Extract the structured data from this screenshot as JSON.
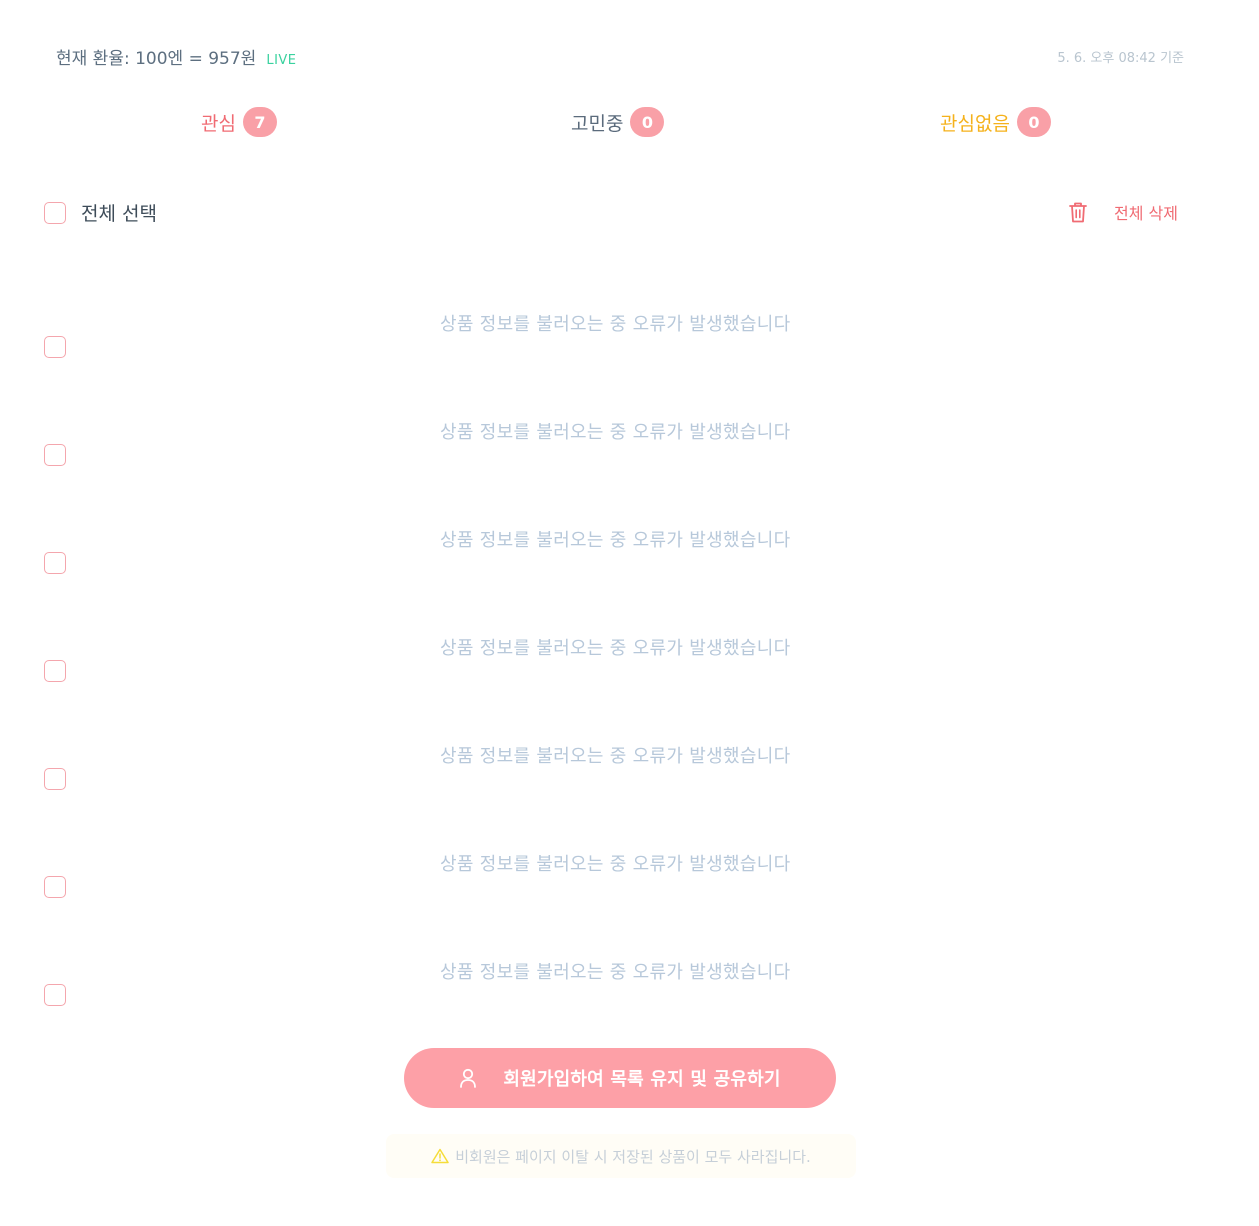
{
  "header": {
    "exchange_rate": "현재 환율: 100엔 = 957원",
    "live_label": "LIVE",
    "updated_text": "5. 6. 오후 08:42 기준"
  },
  "tabs": [
    {
      "label": "관심",
      "count": "7",
      "color": "#f06b73"
    },
    {
      "label": "고민중",
      "count": "0",
      "color": "#5b6b7c"
    },
    {
      "label": "관심없음",
      "count": "0",
      "color": "#f5b21c"
    }
  ],
  "selection": {
    "select_all_label": "전체 선택",
    "delete_all_label": "전체 삭제"
  },
  "items": [
    {
      "message": "상품 정보를 불러오는 중 오류가 발생했습니다"
    },
    {
      "message": "상품 정보를 불러오는 중 오류가 발생했습니다"
    },
    {
      "message": "상품 정보를 불러오는 중 오류가 발생했습니다"
    },
    {
      "message": "상품 정보를 불러오는 중 오류가 발생했습니다"
    },
    {
      "message": "상품 정보를 불러오는 중 오류가 발생했습니다"
    },
    {
      "message": "상품 정보를 불러오는 중 오류가 발생했습니다"
    },
    {
      "message": "상품 정보를 불러오는 중 오류가 발생했습니다"
    }
  ],
  "signup": {
    "label": "회원가입하여 목록 유지 및 공유하기"
  },
  "warning": {
    "text": "비회원은 페이지 이탈 시 저장된 상품이 모두 사라집니다."
  },
  "colors": {
    "accent": "#fda0a7",
    "live": "#3ad29f",
    "error_text": "#b7c8da"
  },
  "icons": {
    "delete": "trash-icon",
    "signup": "user-icon",
    "warning": "warning-triangle-icon"
  }
}
